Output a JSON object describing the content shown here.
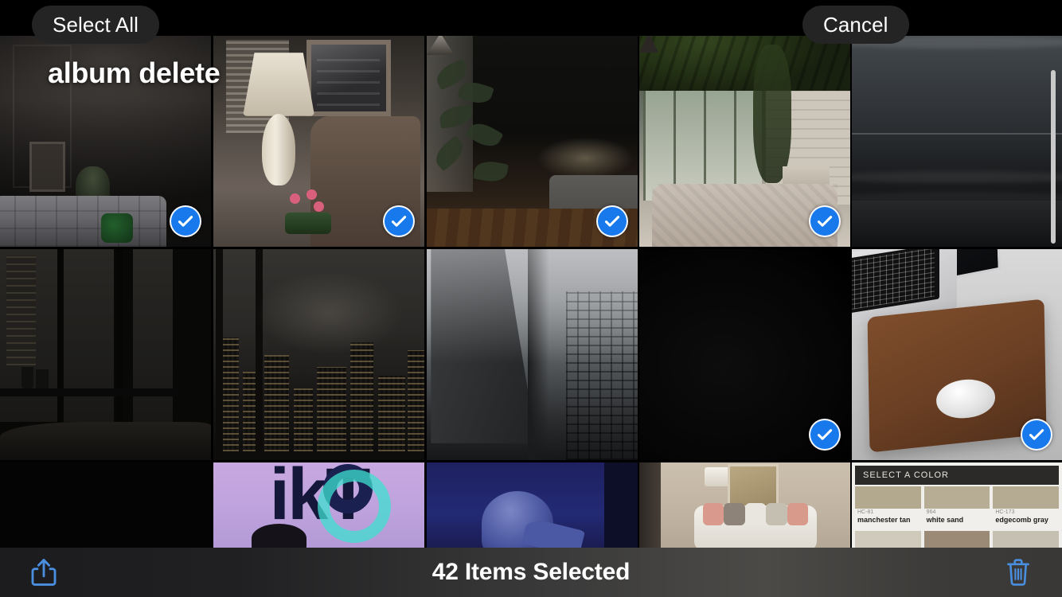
{
  "topbar": {
    "select_all_label": "Select All",
    "cancel_label": "Cancel",
    "album_title": "album delete"
  },
  "bottombar": {
    "selection_count": "42 Items Selected",
    "share_icon": "share-icon",
    "trash_icon": "trash-icon",
    "icon_color": "#4a8ee0"
  },
  "colors": {
    "accent_blue": "#1879ED",
    "pill_bg": "#242424",
    "toolbar_text": "#ffffff",
    "scrollbar": "#c9c9c9"
  },
  "grid": {
    "columns": 5,
    "rows": 3,
    "photos": [
      {
        "id": "p1",
        "name": "living-room-sofa",
        "alt": "Dim living room with grey tufted sofa and framed art",
        "selected": true
      },
      {
        "id": "p2",
        "name": "lamp-chair",
        "alt": "Table lamp, mirror, leather chair and pink flowers",
        "selected": true
      },
      {
        "id": "p3",
        "name": "bedroom-plants",
        "alt": "Dark bedroom with indoor plants and pendant lamps",
        "selected": true
      },
      {
        "id": "p4",
        "name": "conservatory-bed",
        "alt": "Conservatory bedroom with glass wall and greenery",
        "selected": true
      },
      {
        "id": "p5",
        "name": "dark-seascape",
        "alt": "Dark seascape with overcast sky and shoreline",
        "selected": false
      },
      {
        "id": "p6",
        "name": "night-window-interior",
        "alt": "Night interior looking through window to city",
        "selected": false
      },
      {
        "id": "p7",
        "name": "city-skyline-night",
        "alt": "Foggy city skyline at night seen through window",
        "selected": false
      },
      {
        "id": "p8",
        "name": "foggy-tower",
        "alt": "Foggy high-rise building facade",
        "selected": false
      },
      {
        "id": "p9",
        "name": "black-frame",
        "alt": "Almost entirely black frame",
        "selected": true
      },
      {
        "id": "p10",
        "name": "mousepad-desk",
        "alt": "Laptop with brown leather mousepad and white mouse",
        "selected": true
      },
      {
        "id": "p11",
        "name": "black-thumb",
        "alt": "Black thumbnail",
        "selected": false
      },
      {
        "id": "p12",
        "name": "tiktok-logo",
        "alt": "TikTok logo on lavender background",
        "selected": false
      },
      {
        "id": "p13",
        "name": "navy-figure",
        "alt": "Figure on deep navy blue background",
        "selected": false
      },
      {
        "id": "p14",
        "name": "beige-living-room",
        "alt": "Beige living room with white sofa and pillows",
        "selected": false
      },
      {
        "id": "p15",
        "name": "paint-color-chart",
        "alt": "Paint colour selection chart",
        "selected": false
      }
    ]
  },
  "paint_chart": {
    "header": "SELECT A COLOR",
    "swatches": [
      {
        "code": "HC-81",
        "name": "manchester tan",
        "hex": "#b2a98f"
      },
      {
        "code": "964",
        "name": "white sand",
        "hex": "#b6ad94"
      },
      {
        "code": "HC-173",
        "name": "edgecomb gray",
        "hex": "#b4ab92"
      }
    ],
    "row2": [
      "#cfcabc",
      "#9b8b76",
      "#c6c0b2"
    ]
  }
}
